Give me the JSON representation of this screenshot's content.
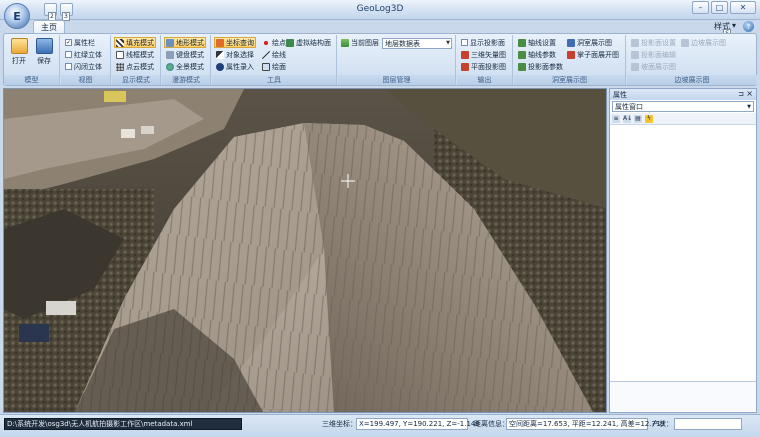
{
  "window": {
    "title": "GeoLog3D",
    "orb_letter": "E",
    "qat_keytips": [
      "2",
      "3"
    ],
    "active_tab": "主页",
    "style_menu": "样式",
    "help_keytip": "S"
  },
  "ribbon": {
    "groups": [
      {
        "label": "模型",
        "buttons": [
          "打开",
          "保存"
        ]
      },
      {
        "label": "视图",
        "items": [
          {
            "label": "属性栏",
            "checked": true
          },
          {
            "label": "红绿立体",
            "checked": false
          },
          {
            "label": "闪闭立体",
            "checked": false
          }
        ]
      },
      {
        "label": "显示模式",
        "items": [
          "填充模式",
          "线框模式",
          "点云模式"
        ],
        "active": "填充模式"
      },
      {
        "label": "漫游模式",
        "items": [
          "地形模式",
          "键盘模式",
          "全景模式"
        ],
        "active": "地形模式"
      },
      {
        "label": "工具",
        "items": [
          "坐标查询",
          "对象选择",
          "属性录入",
          "绘点",
          "绘线",
          "绘面",
          "虚拟结构面"
        ],
        "active": "坐标查询"
      },
      {
        "label": "图层管理",
        "current_layer_label": "当前图层",
        "layer_value": "地层数据表"
      },
      {
        "label": "输出",
        "items": [
          "显示投影面",
          "三维矢量图",
          "平面投影图"
        ]
      },
      {
        "label": "洞室展示图",
        "items": [
          "轴线设置",
          "轴线参数",
          "投影面参数",
          "洞室展示图",
          "掌子面展开图"
        ]
      },
      {
        "label": "边坡展示图",
        "items": [
          "投影面设置",
          "投影面编辑",
          "坡面展示图",
          "边坡展示图"
        ]
      }
    ]
  },
  "panel": {
    "title": "属性",
    "selector": "属性窗口"
  },
  "status": {
    "file_path": "D:\\系统开发\\osg3d\\无人机航拍摄影工作区\\metadata.xml",
    "coord_label": "三维坐标：",
    "coord_value": "X=199.497, Y=190.221, Z=-1.148",
    "distance_label": "距离信息：",
    "distance_value": "空间距离=17.653, 平距=12.241, 高差=12.719",
    "dip_label": "产状："
  }
}
